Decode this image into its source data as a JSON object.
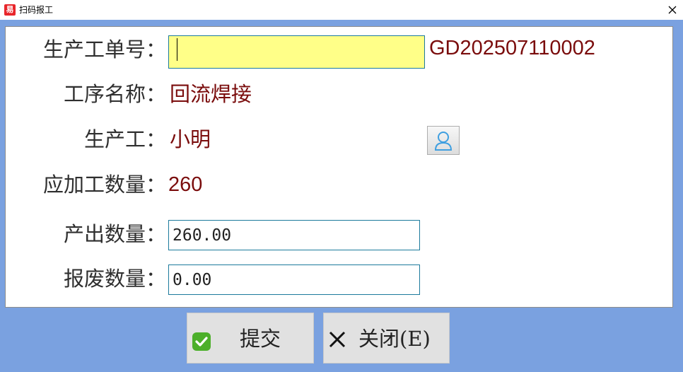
{
  "window": {
    "title": "扫码报工",
    "app_icon_glyph": "易",
    "app_icon_color": "#e8262b",
    "close_icon": "close-icon"
  },
  "form": {
    "order_no": {
      "label": "生产工单号：",
      "value": "",
      "display": "GD202507110002"
    },
    "process_name": {
      "label": "工序名称：",
      "value": "回流焊接"
    },
    "worker": {
      "label": "生产工：",
      "value": "小明",
      "icon": "user-icon"
    },
    "planned_qty": {
      "label": "应加工数量：",
      "value": "260"
    },
    "output_qty": {
      "label": "产出数量：",
      "value": "260.00"
    },
    "scrap_qty": {
      "label": "报废数量：",
      "value": "0.00"
    }
  },
  "buttons": {
    "submit": {
      "label": "提交",
      "icon": "check-icon"
    },
    "close": {
      "label": "关闭(E)",
      "icon": "x-icon"
    }
  },
  "colors": {
    "value_text": "#7a0c0c",
    "background": "#7aa1e0",
    "input_highlight": "#ffff88",
    "input_border": "#1c7a9c",
    "check_green": "#4caf2a"
  }
}
